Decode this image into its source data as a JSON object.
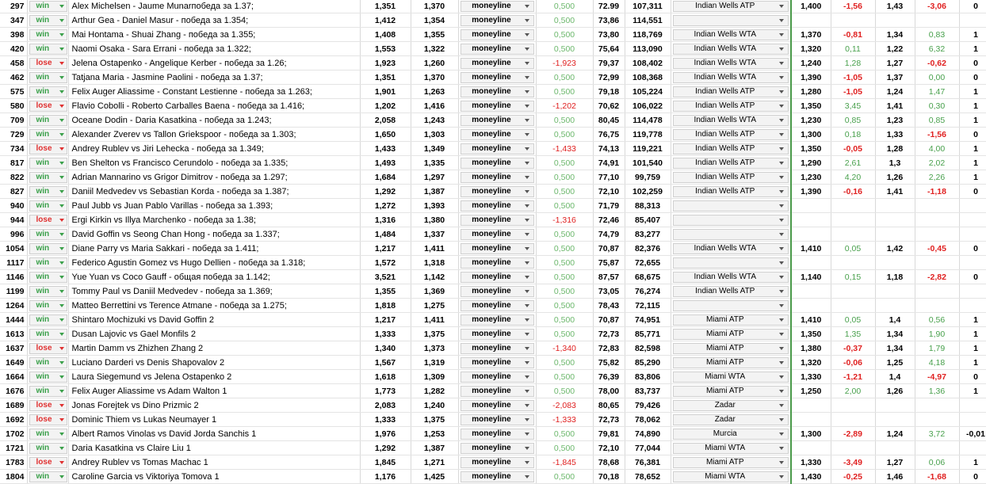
{
  "rows": [
    {
      "id": "297",
      "result": "win",
      "match": "Alex Michelsen - Jaume Munarпобеда за 1.37;",
      "o1": "1,351",
      "o2": "1,370",
      "market": "moneyline",
      "profit": "0,500",
      "pct": "72.99",
      "val": "107,311",
      "tournament": "Indian Wells ATP",
      "e1": "1,400",
      "e2": "-1,56",
      "e3": "1,43",
      "e4": "-3,06",
      "e5": "0"
    },
    {
      "id": "347",
      "result": "win",
      "match": "Arthur Gea - Daniel Masur - победа за 1.354;",
      "o1": "1,412",
      "o2": "1,354",
      "market": "moneyline",
      "profit": "0,500",
      "pct": "73,86",
      "val": "114,551",
      "tournament": "",
      "e1": "",
      "e2": "",
      "e3": "",
      "e4": "",
      "e5": ""
    },
    {
      "id": "398",
      "result": "win",
      "match": "Mai Hontama - Shuai Zhang - победа за 1.355;",
      "o1": "1,408",
      "o2": "1,355",
      "market": "moneyline",
      "profit": "0,500",
      "pct": "73,80",
      "val": "118,769",
      "tournament": "Indian Wells WTA",
      "e1": "1,370",
      "e2": "-0,81",
      "e3": "1,34",
      "e4": "0,83",
      "e5": "1"
    },
    {
      "id": "420",
      "result": "win",
      "match": "Naomi Osaka - Sara Errani - победа за 1.322;",
      "o1": "1,553",
      "o2": "1,322",
      "market": "moneyline",
      "profit": "0,500",
      "pct": "75,64",
      "val": "113,090",
      "tournament": "Indian Wells WTA",
      "e1": "1,320",
      "e2": "0,11",
      "e3": "1,22",
      "e4": "6,32",
      "e5": "1"
    },
    {
      "id": "458",
      "result": "lose",
      "match": "Jelena Ostapenko - Angelique Kerber - победа за 1.26;",
      "o1": "1,923",
      "o2": "1,260",
      "market": "moneyline",
      "profit": "-1,923",
      "pct": "79,37",
      "val": "108,402",
      "tournament": "Indian Wells WTA",
      "e1": "1,240",
      "e2": "1,28",
      "e3": "1,27",
      "e4": "-0,62",
      "e5": "0"
    },
    {
      "id": "462",
      "result": "win",
      "match": "Tatjana Maria - Jasmine Paolini - победа за 1.37;",
      "o1": "1,351",
      "o2": "1,370",
      "market": "moneyline",
      "profit": "0,500",
      "pct": "72,99",
      "val": "108,368",
      "tournament": "Indian Wells WTA",
      "e1": "1,390",
      "e2": "-1,05",
      "e3": "1,37",
      "e4": "0,00",
      "e5": "0"
    },
    {
      "id": "575",
      "result": "win",
      "match": "Felix Auger Aliassime - Constant Lestienne - победа за 1.263;",
      "o1": "1,901",
      "o2": "1,263",
      "market": "moneyline",
      "profit": "0,500",
      "pct": "79,18",
      "val": "105,224",
      "tournament": "Indian Wells ATP",
      "e1": "1,280",
      "e2": "-1,05",
      "e3": "1,24",
      "e4": "1,47",
      "e5": "1"
    },
    {
      "id": "580",
      "result": "lose",
      "match": "Flavio Cobolli - Roberto Carballes Baena - победа за 1.416;",
      "o1": "1,202",
      "o2": "1,416",
      "market": "moneyline",
      "profit": "-1,202",
      "pct": "70,62",
      "val": "106,022",
      "tournament": "Indian Wells ATP",
      "e1": "1,350",
      "e2": "3,45",
      "e3": "1,41",
      "e4": "0,30",
      "e5": "1"
    },
    {
      "id": "709",
      "result": "win",
      "match": "Oceane Dodin - Daria Kasatkina - победа за 1.243;",
      "o1": "2,058",
      "o2": "1,243",
      "market": "moneyline",
      "profit": "0,500",
      "pct": "80,45",
      "val": "114,478",
      "tournament": "Indian Wells WTA",
      "e1": "1,230",
      "e2": "0,85",
      "e3": "1,23",
      "e4": "0,85",
      "e5": "1"
    },
    {
      "id": "729",
      "result": "win",
      "match": "Alexander Zverev vs Tallon Griekspoor - победа за 1.303;",
      "o1": "1,650",
      "o2": "1,303",
      "market": "moneyline",
      "profit": "0,500",
      "pct": "76,75",
      "val": "119,778",
      "tournament": "Indian Wells ATP",
      "e1": "1,300",
      "e2": "0,18",
      "e3": "1,33",
      "e4": "-1,56",
      "e5": "0"
    },
    {
      "id": "734",
      "result": "lose",
      "match": "Andrey Rublev vs Jiri Lehecka - победа за 1.349;",
      "o1": "1,433",
      "o2": "1,349",
      "market": "moneyline",
      "profit": "-1,433",
      "pct": "74,13",
      "val": "119,221",
      "tournament": "Indian Wells ATP",
      "e1": "1,350",
      "e2": "-0,05",
      "e3": "1,28",
      "e4": "4,00",
      "e5": "1"
    },
    {
      "id": "817",
      "result": "win",
      "match": "Ben Shelton vs Francisco Cerundolo - победа за 1.335;",
      "o1": "1,493",
      "o2": "1,335",
      "market": "moneyline",
      "profit": "0,500",
      "pct": "74,91",
      "val": "101,540",
      "tournament": "Indian Wells ATP",
      "e1": "1,290",
      "e2": "2,61",
      "e3": "1,3",
      "e4": "2,02",
      "e5": "1"
    },
    {
      "id": "822",
      "result": "win",
      "match": "Adrian Mannarino vs Grigor Dimitrov - победа за 1.297;",
      "o1": "1,684",
      "o2": "1,297",
      "market": "moneyline",
      "profit": "0,500",
      "pct": "77,10",
      "val": "99,759",
      "tournament": "Indian Wells ATP",
      "e1": "1,230",
      "e2": "4,20",
      "e3": "1,26",
      "e4": "2,26",
      "e5": "1"
    },
    {
      "id": "827",
      "result": "win",
      "match": "Daniil Medvedev vs Sebastian Korda - победа за 1.387;",
      "o1": "1,292",
      "o2": "1,387",
      "market": "moneyline",
      "profit": "0,500",
      "pct": "72,10",
      "val": "102,259",
      "tournament": "Indian Wells ATP",
      "e1": "1,390",
      "e2": "-0,16",
      "e3": "1,41",
      "e4": "-1,18",
      "e5": "0"
    },
    {
      "id": "940",
      "result": "win",
      "match": "Paul Jubb vs Juan Pablo Varillas - победа за 1.393;",
      "o1": "1,272",
      "o2": "1,393",
      "market": "moneyline",
      "profit": "0,500",
      "pct": "71,79",
      "val": "88,313",
      "tournament": "",
      "e1": "",
      "e2": "",
      "e3": "",
      "e4": "",
      "e5": ""
    },
    {
      "id": "944",
      "result": "lose",
      "match": "Ergi Kirkin vs Illya Marchenko - победа за 1.38;",
      "o1": "1,316",
      "o2": "1,380",
      "market": "moneyline",
      "profit": "-1,316",
      "pct": "72,46",
      "val": "85,407",
      "tournament": "",
      "e1": "",
      "e2": "",
      "e3": "",
      "e4": "",
      "e5": ""
    },
    {
      "id": "996",
      "result": "win",
      "match": "David Goffin vs Seong Chan Hong - победа за 1.337;",
      "o1": "1,484",
      "o2": "1,337",
      "market": "moneyline",
      "profit": "0,500",
      "pct": "74,79",
      "val": "83,277",
      "tournament": "",
      "e1": "",
      "e2": "",
      "e3": "",
      "e4": "",
      "e5": ""
    },
    {
      "id": "1054",
      "result": "win",
      "match": "Diane Parry vs Maria Sakkari - победа за 1.411;",
      "o1": "1,217",
      "o2": "1,411",
      "market": "moneyline",
      "profit": "0,500",
      "pct": "70,87",
      "val": "82,376",
      "tournament": "Indian Wells WTA",
      "e1": "1,410",
      "e2": "0,05",
      "e3": "1,42",
      "e4": "-0,45",
      "e5": "0"
    },
    {
      "id": "1117",
      "result": "win",
      "match": "Federico Agustin Gomez vs Hugo Dellien - победа за 1.318;",
      "o1": "1,572",
      "o2": "1,318",
      "market": "moneyline",
      "profit": "0,500",
      "pct": "75,87",
      "val": "72,655",
      "tournament": "",
      "e1": "",
      "e2": "",
      "e3": "",
      "e4": "",
      "e5": ""
    },
    {
      "id": "1146",
      "result": "win",
      "match": "Yue Yuan vs Coco Gauff - общая победа за 1.142;",
      "o1": "3,521",
      "o2": "1,142",
      "market": "moneyline",
      "profit": "0,500",
      "pct": "87,57",
      "val": "68,675",
      "tournament": "Indian Wells WTA",
      "e1": "1,140",
      "e2": "0,15",
      "e3": "1,18",
      "e4": "-2,82",
      "e5": "0"
    },
    {
      "id": "1199",
      "result": "win",
      "match": "Tommy Paul vs Daniil Medvedev - победа за 1.369;",
      "o1": "1,355",
      "o2": "1,369",
      "market": "moneyline",
      "profit": "0,500",
      "pct": "73,05",
      "val": "76,274",
      "tournament": "Indian Wells ATP",
      "e1": "",
      "e2": "",
      "e3": "",
      "e4": "",
      "e5": ""
    },
    {
      "id": "1264",
      "result": "win",
      "match": "Matteo Berrettini vs Terence Atmane - победа за 1.275;",
      "o1": "1,818",
      "o2": "1,275",
      "market": "moneyline",
      "profit": "0,500",
      "pct": "78,43",
      "val": "72,115",
      "tournament": "",
      "e1": "",
      "e2": "",
      "e3": "",
      "e4": "",
      "e5": ""
    },
    {
      "id": "1444",
      "result": "win",
      "match": "Shintaro Mochizuki  vs  David Goffin 2",
      "o1": "1,217",
      "o2": "1,411",
      "market": "moneyline",
      "profit": "0,500",
      "pct": "70,87",
      "val": "74,951",
      "tournament": "Miami ATP",
      "e1": "1,410",
      "e2": "0,05",
      "e3": "1,4",
      "e4": "0,56",
      "e5": "1"
    },
    {
      "id": "1613",
      "result": "win",
      "match": "Dusan Lajovic  vs  Gael Monfils 2",
      "o1": "1,333",
      "o2": "1,375",
      "market": "moneyline",
      "profit": "0,500",
      "pct": "72,73",
      "val": "85,771",
      "tournament": "Miami ATP",
      "e1": "1,350",
      "e2": "1,35",
      "e3": "1,34",
      "e4": "1,90",
      "e5": "1"
    },
    {
      "id": "1637",
      "result": "lose",
      "match": "Martin Damm  vs  Zhizhen Zhang 2",
      "o1": "1,340",
      "o2": "1,373",
      "market": "moneyline",
      "profit": "-1,340",
      "pct": "72,83",
      "val": "82,598",
      "tournament": "Miami ATP",
      "e1": "1,380",
      "e2": "-0,37",
      "e3": "1,34",
      "e4": "1,79",
      "e5": "1"
    },
    {
      "id": "1649",
      "result": "win",
      "match": " Luciano Darderi  vs  Denis Shapovalov 2",
      "o1": "1,567",
      "o2": "1,319",
      "market": "moneyline",
      "profit": "0,500",
      "pct": "75,82",
      "val": "85,290",
      "tournament": "Miami ATP",
      "e1": "1,320",
      "e2": "-0,06",
      "e3": "1,25",
      "e4": "4,18",
      "e5": "1"
    },
    {
      "id": "1664",
      "result": "win",
      "match": " Laura Siegemund  vs  Jelena Ostapenko 2",
      "o1": "1,618",
      "o2": "1,309",
      "market": "moneyline",
      "profit": "0,500",
      "pct": "76,39",
      "val": "83,806",
      "tournament": "Miami WTA",
      "e1": "1,330",
      "e2": "-1,21",
      "e3": "1,4",
      "e4": "-4,97",
      "e5": "0"
    },
    {
      "id": "1676",
      "result": "win",
      "match": " Felix Auger Aliassime  vs  Adam Walton 1",
      "o1": "1,773",
      "o2": "1,282",
      "market": "moneyline",
      "profit": "0,500",
      "pct": "78,00",
      "val": "83,737",
      "tournament": "Miami ATP",
      "e1": "1,250",
      "e2": "2,00",
      "e3": "1,26",
      "e4": "1,36",
      "e5": "1"
    },
    {
      "id": "1689",
      "result": "lose",
      "match": "Jonas Forejtek  vs  Dino Prizmic 2",
      "o1": "2,083",
      "o2": "1,240",
      "market": "moneyline",
      "profit": "-2,083",
      "pct": "80,65",
      "val": "79,426",
      "tournament": "Zadar",
      "e1": "",
      "e2": "",
      "e3": "",
      "e4": "",
      "e5": ""
    },
    {
      "id": "1692",
      "result": "lose",
      "match": "Dominic Thiem  vs  Lukas Neumayer 1",
      "o1": "1,333",
      "o2": "1,375",
      "market": "moneyline",
      "profit": "-1,333",
      "pct": "72,73",
      "val": "78,062",
      "tournament": "Zadar",
      "e1": "",
      "e2": "",
      "e3": "",
      "e4": "",
      "e5": ""
    },
    {
      "id": "1702",
      "result": "win",
      "match": "Albert Ramos Vinolas  vs  David Jorda Sanchis 1",
      "o1": "1,976",
      "o2": "1,253",
      "market": "moneyline",
      "profit": "0,500",
      "pct": "79,81",
      "val": "74,890",
      "tournament": "Murcia",
      "e1": "1,300",
      "e2": "-2,89",
      "e3": "1,24",
      "e4": "3,72",
      "e5": "-0,01"
    },
    {
      "id": "1721",
      "result": "win",
      "match": "Daria Kasatkina  vs  Claire Liu 1",
      "o1": "1,292",
      "o2": "1,387",
      "market": "moneyline",
      "profit": "0,500",
      "pct": "72,10",
      "val": "77,044",
      "tournament": "Miami WTA",
      "e1": "",
      "e2": "",
      "e3": "",
      "e4": "",
      "e5": ""
    },
    {
      "id": "1783",
      "result": "lose",
      "match": "Andrey Rublev  vs  Tomas Machac 1",
      "o1": "1,845",
      "o2": "1,271",
      "market": "moneyline",
      "profit": "-1,845",
      "pct": "78,68",
      "val": "76,381",
      "tournament": "Miami ATP",
      "e1": "1,330",
      "e2": "-3,49",
      "e3": "1,27",
      "e4": "0,06",
      "e5": "1"
    },
    {
      "id": "1804",
      "result": "win",
      "match": "Caroline Garcia  vs  Viktoriya Tomova 1",
      "o1": "1,176",
      "o2": "1,425",
      "market": "moneyline",
      "profit": "0,500",
      "pct": "70,18",
      "val": "78,652",
      "tournament": "Miami WTA",
      "e1": "1,430",
      "e2": "-0,25",
      "e3": "1,46",
      "e4": "-1,68",
      "e5": "0"
    }
  ]
}
